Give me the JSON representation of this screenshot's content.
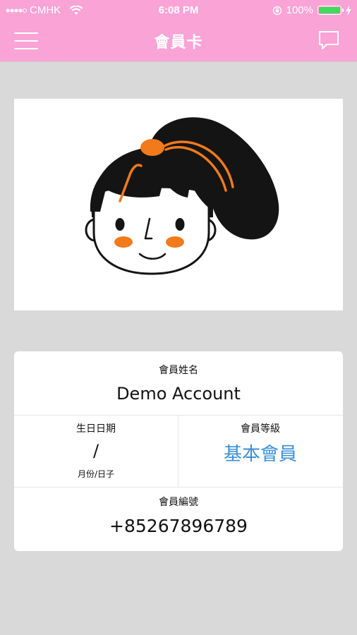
{
  "status_bar": {
    "carrier": "CMHK",
    "time": "6:08 PM",
    "battery": "100%",
    "battery_level": 1.0
  },
  "nav": {
    "title": "會員卡",
    "menu_icon": "hamburger-menu-icon",
    "chat_icon": "chat-bubble-icon"
  },
  "colors": {
    "header": "#f9a3d6",
    "background": "#d9d9d9",
    "tier_text": "#3a8fd6",
    "hair": "#141414",
    "accent_orange": "#f27a1a"
  },
  "member": {
    "name_label": "會員姓名",
    "name": "Demo Account",
    "dob_label": "生日日期",
    "dob_value": "/",
    "dob_hint": "月份/日子",
    "tier_label": "會員等級",
    "tier_value": "基本會員",
    "number_label": "會員編號",
    "number_value": "+85267896789"
  }
}
